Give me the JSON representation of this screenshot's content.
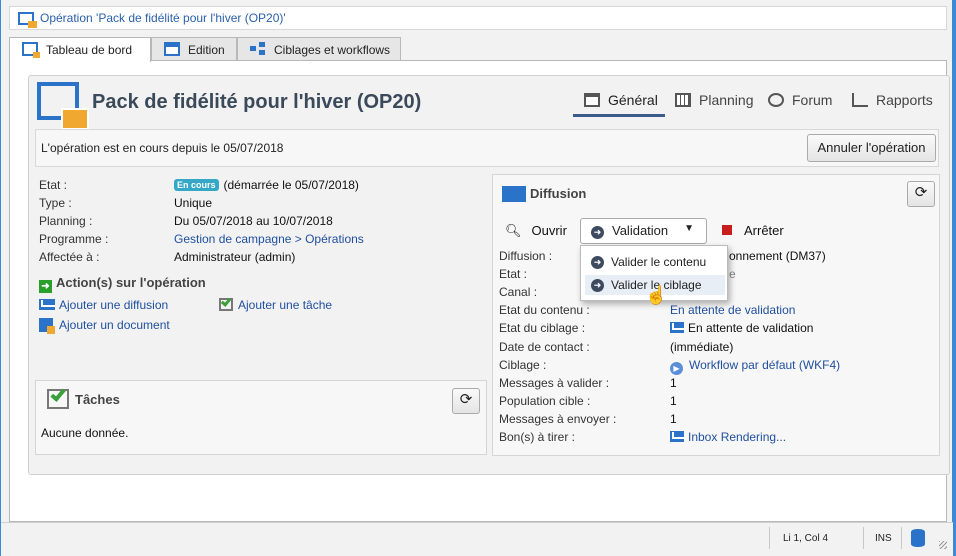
{
  "window": {
    "title": "Opération 'Pack de fidélité pour l'hiver (OP20)'"
  },
  "tabs": [
    {
      "label": "Tableau de bord"
    },
    {
      "label": "Edition"
    },
    {
      "label": "Ciblages et workflows"
    }
  ],
  "operation": {
    "title": "Pack de fidélité pour l'hiver (OP20)"
  },
  "topnav": {
    "general": "Général",
    "planning": "Planning",
    "forum": "Forum",
    "rapports": "Rapports"
  },
  "status_banner": {
    "text": "L'opération est en cours depuis le 05/07/2018",
    "cancel_button": "Annuler l'opération"
  },
  "details": {
    "etat_label": "Etat :",
    "etat_badge": "En cours",
    "etat_value": "(démarrée le 05/07/2018)",
    "type_label": "Type :",
    "type_value": "Unique",
    "planning_label": "Planning :",
    "planning_value": "Du 05/07/2018 au 10/07/2018",
    "programme_label": "Programme :",
    "programme_value": "Gestion de campagne > Opérations",
    "affectee_label": "Affectée à :",
    "affectee_value": "Administrateur (admin)"
  },
  "actions": {
    "heading": "Action(s) sur l'opération",
    "add_delivery": "Ajouter une diffusion",
    "add_task": "Ajouter une tâche",
    "add_document": "Ajouter un document"
  },
  "tasks": {
    "heading": "Tâches",
    "empty": "Aucune donnée."
  },
  "diffusion": {
    "heading": "Diffusion",
    "open": "Ouvrir",
    "validation": "Validation",
    "stop": "Arrêter",
    "rows": {
      "diffusion_label": "Diffusion :",
      "diffusion_value": "onnement (DM37)",
      "etat_label": "Etat :",
      "etat_value": "e",
      "canal_label": "Canal :",
      "contenu_label": "Etat du contenu :",
      "contenu_value": "En attente de validation",
      "ciblage_etat_label": "Etat du ciblage :",
      "ciblage_etat_value": "En attente de validation",
      "contact_label": "Date de contact :",
      "contact_value": "(immédiate)",
      "ciblage_label": "Ciblage :",
      "ciblage_value": "Workflow par défaut (WKF4)",
      "messages_valider_label": "Messages à valider :",
      "messages_valider_value": "1",
      "population_label": "Population cible :",
      "population_value": "1",
      "messages_envoyer_label": "Messages à envoyer :",
      "messages_envoyer_value": "1",
      "bat_label": "Bon(s) à tirer :",
      "bat_value": "Inbox Rendering..."
    },
    "menu": {
      "validate_content": "Valider le contenu",
      "validate_targeting": "Valider le ciblage"
    }
  },
  "statusbar": {
    "position": "Li 1, Col 4",
    "mode": "INS"
  },
  "colors": {
    "accent": "#2a73c8",
    "link": "#1f4f9e",
    "badge": "#35a8c8",
    "orange": "#f0a830"
  }
}
